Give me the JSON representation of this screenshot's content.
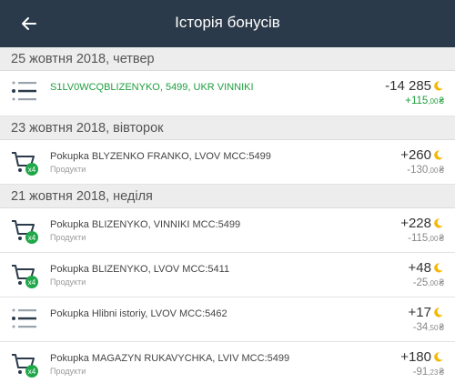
{
  "header": {
    "title": "Історія бонусів"
  },
  "groups": [
    {
      "date": "25 жовтня 2018, четвер",
      "items": [
        {
          "title": "S1LV0WCQBLIZENYKO, 5499, UKR VINNIKI",
          "subtitle": "",
          "bonus": "-14 285",
          "money_int": "+115",
          "money_cents": ",00",
          "currency": "₴",
          "icon": "list-icon"
        }
      ]
    },
    {
      "date": "23 жовтня 2018, вівторок",
      "items": [
        {
          "title": "Pokupka BLYZENKO FRANKO, LVOV MCC:5499",
          "subtitle": "Продукти",
          "bonus": "+260",
          "money_int": "-130",
          "money_cents": ",00",
          "currency": "₴",
          "icon": "cart-icon",
          "badge": "x4"
        }
      ]
    },
    {
      "date": "21 жовтня 2018, неділя",
      "items": [
        {
          "title": "Pokupka BLIZENYKO, VINNIKI MCC:5499",
          "subtitle": "Продукти",
          "bonus": "+228",
          "money_int": "-115",
          "money_cents": ",00",
          "currency": "₴",
          "icon": "cart-icon",
          "badge": "x4"
        },
        {
          "title": "Pokupka BLIZENYKO, LVOV MCC:5411",
          "subtitle": "Продукти",
          "bonus": "+48",
          "money_int": "-25",
          "money_cents": ",00",
          "currency": "₴",
          "icon": "cart-icon",
          "badge": "x4"
        },
        {
          "title": "Pokupka Hlibni istoriy, LVOV MCC:5462",
          "subtitle": "",
          "bonus": "+17",
          "money_int": "-34",
          "money_cents": ",50",
          "currency": "₴",
          "icon": "list-icon"
        },
        {
          "title": "Pokupka MAGAZYN RUKAVYCHKA, LVIV MCC:5499",
          "subtitle": "Продукти",
          "bonus": "+180",
          "money_int": "-91",
          "money_cents": ",23",
          "currency": "₴",
          "icon": "cart-icon",
          "badge": "x4"
        }
      ]
    }
  ],
  "colors": {
    "header_bg": "#2b3a4a",
    "positive_green": "#1e9e3e",
    "bonus_yellow": "#f5b800",
    "badge_green": "#1fa84a"
  }
}
